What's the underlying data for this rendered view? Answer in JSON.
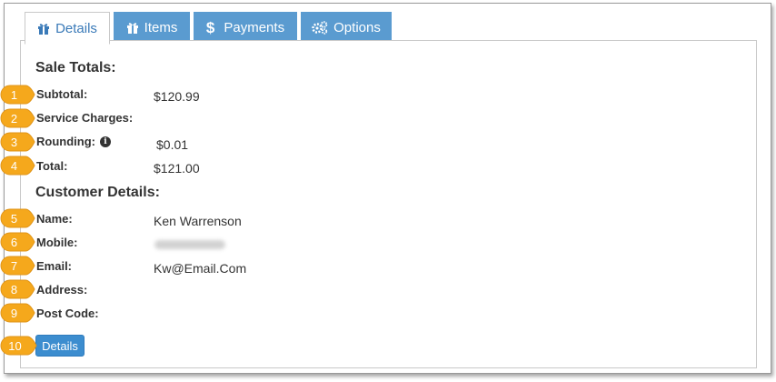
{
  "tabs": [
    {
      "label": "Details",
      "icon": "gift-icon",
      "active": true
    },
    {
      "label": "Items",
      "icon": "gift-icon",
      "active": false
    },
    {
      "label": "Payments",
      "icon": "dollar-icon",
      "active": false
    },
    {
      "label": "Options",
      "icon": "gears-icon",
      "active": false
    }
  ],
  "sale_totals": {
    "title": "Sale Totals:",
    "subtotal_label": "Subtotal:",
    "subtotal_value": "$120.99",
    "service_label": "Service Charges:",
    "service_value": "",
    "rounding_label": "Rounding:",
    "rounding_value": "$0.01",
    "total_label": "Total:",
    "total_value": "$121.00"
  },
  "customer": {
    "title": "Customer Details:",
    "name_label": "Name:",
    "name_value": "Ken Warrenson",
    "mobile_label": "Mobile:",
    "email_label": "Email:",
    "email_value": "Kw@Email.Com",
    "address_label": "Address:",
    "postcode_label": "Post Code:"
  },
  "details_button": "Details",
  "callouts": [
    "1",
    "2",
    "3",
    "4",
    "5",
    "6",
    "7",
    "8",
    "9",
    "10"
  ],
  "colors": {
    "tab_bg": "#5a9bd0",
    "active_tab_text": "#3a7ab8",
    "callout": "#f5a81c",
    "button": "#3c8dcf"
  }
}
